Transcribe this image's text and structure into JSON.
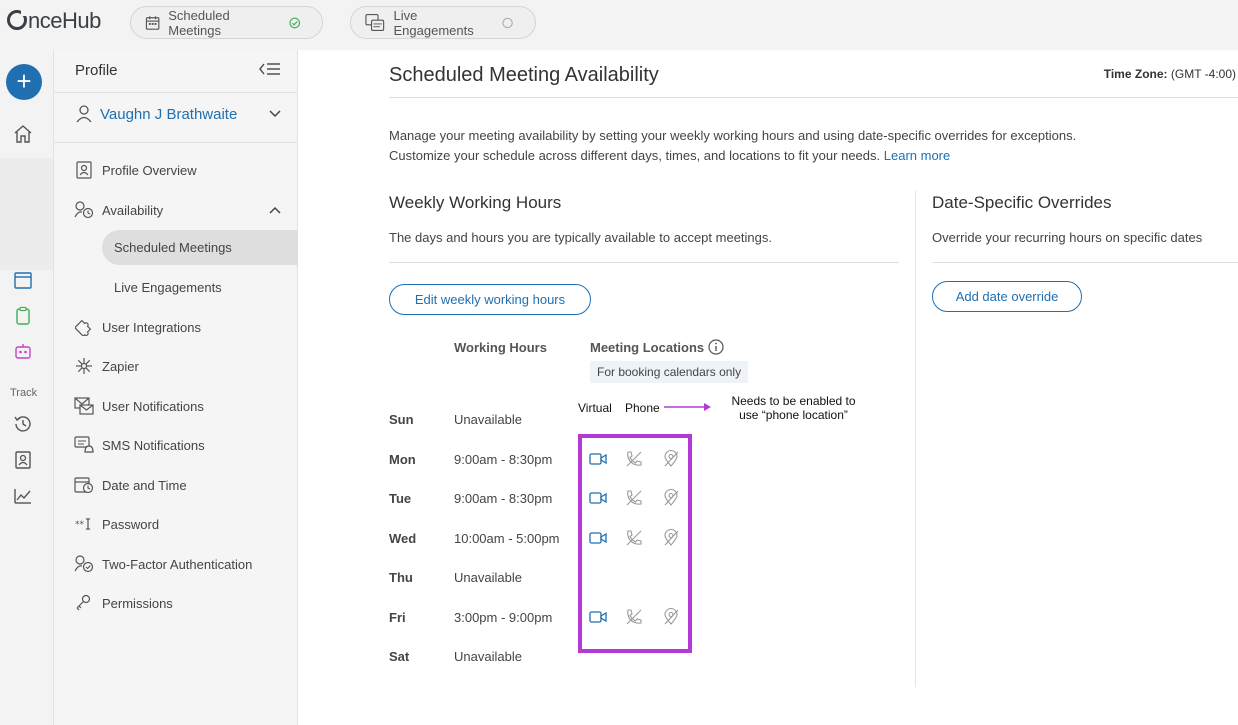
{
  "topbar": {
    "logo": "nceHub",
    "tabs": [
      {
        "label": "Scheduled Meetings",
        "status": "active"
      },
      {
        "label": "Live Engagements",
        "status": "inactive"
      }
    ]
  },
  "rail": {
    "track_label": "Track"
  },
  "sidebar": {
    "title": "Profile",
    "user_name": "Vaughn J Brathwaite",
    "items": [
      {
        "label": "Profile Overview"
      },
      {
        "label": "Availability"
      },
      {
        "label": "User Integrations"
      },
      {
        "label": "Zapier"
      },
      {
        "label": "User Notifications"
      },
      {
        "label": "SMS Notifications"
      },
      {
        "label": "Date and Time"
      },
      {
        "label": "Password"
      },
      {
        "label": "Two-Factor Authentication"
      },
      {
        "label": "Permissions"
      }
    ],
    "availability_sub": [
      {
        "label": "Scheduled Meetings"
      },
      {
        "label": "Live Engagements"
      }
    ]
  },
  "main": {
    "title": "Scheduled Meeting Availability",
    "timezone_label": "Time Zone:",
    "timezone_value": "(GMT -4:00)",
    "description_line1": "Manage your meeting availability by setting your weekly working hours and using date-specific overrides for exceptions.",
    "description_line2": "Customize your schedule across different days, times, and locations to fit your needs.",
    "learn_more": "Learn more",
    "weekly": {
      "title": "Weekly Working Hours",
      "subtitle": "The days and hours you are typically available to accept meetings.",
      "edit_button": "Edit weekly working hours",
      "col_hours": "Working Hours",
      "col_locations": "Meeting Locations",
      "locations_badge": "For booking calendars only",
      "rows": [
        {
          "day": "Sun",
          "hours": "Unavailable"
        },
        {
          "day": "Mon",
          "hours": "9:00am - 8:30pm"
        },
        {
          "day": "Tue",
          "hours": "9:00am - 8:30pm"
        },
        {
          "day": "Wed",
          "hours": "10:00am - 5:00pm"
        },
        {
          "day": "Thu",
          "hours": "Unavailable"
        },
        {
          "day": "Fri",
          "hours": "3:00pm - 9:00pm"
        },
        {
          "day": "Sat",
          "hours": "Unavailable"
        }
      ]
    },
    "overrides": {
      "title": "Date-Specific Overrides",
      "subtitle": "Override your recurring hours on specific dates",
      "add_button": "Add date override"
    }
  },
  "annotations": {
    "virtual": "Virtual",
    "phone": "Phone",
    "note_line1": "Needs to be enabled to",
    "note_line2": "use “phone location”",
    "color": "#b43ad8"
  },
  "colors": {
    "accent": "#1f6fb1",
    "success": "#3fae5a",
    "annotation": "#b43ad8"
  }
}
